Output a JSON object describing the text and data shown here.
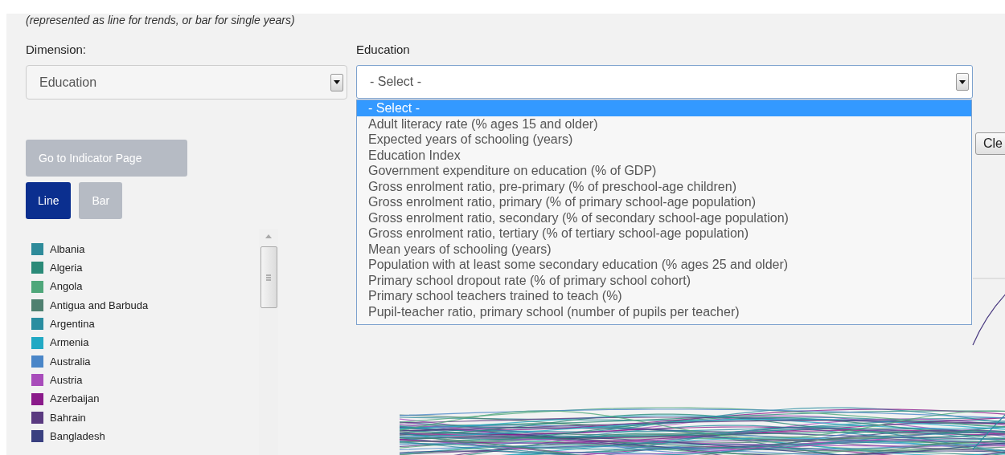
{
  "caption": "(represented as line for trends, or bar for single years)",
  "dimension": {
    "label": "Dimension:",
    "value": "Education"
  },
  "indicator": {
    "label": "Education",
    "value": "- Select -",
    "expanded": true,
    "options": [
      {
        "label": "- Select -",
        "selected": true
      },
      {
        "label": "Adult literacy rate (% ages 15 and older)",
        "selected": false
      },
      {
        "label": "Expected years of schooling (years)",
        "selected": false
      },
      {
        "label": "Education Index",
        "selected": false
      },
      {
        "label": "Government expenditure on education (% of GDP)",
        "selected": false
      },
      {
        "label": "Gross enrolment ratio, pre-primary (% of preschool-age children)",
        "selected": false
      },
      {
        "label": "Gross enrolment ratio, primary (% of primary school-age population)",
        "selected": false
      },
      {
        "label": "Gross enrolment ratio, secondary (% of secondary school-age population)",
        "selected": false
      },
      {
        "label": "Gross enrolment ratio, tertiary (% of tertiary school-age population)",
        "selected": false
      },
      {
        "label": "Mean years of schooling (years)",
        "selected": false
      },
      {
        "label": "Population with at least some secondary education (% ages 25 and older)",
        "selected": false
      },
      {
        "label": "Primary school dropout rate (% of primary school cohort)",
        "selected": false
      },
      {
        "label": "Primary school teachers trained to teach (%)",
        "selected": false
      },
      {
        "label": "Pupil-teacher ratio, primary school (number of pupils per teacher)",
        "selected": false
      }
    ]
  },
  "clear_button": "Cle",
  "indicator_page_button": "Go to Indicator Page",
  "chart_types": [
    {
      "label": "Line",
      "selected": true
    },
    {
      "label": "Bar",
      "selected": false
    }
  ],
  "countries": [
    {
      "name": "Albania",
      "color": "#2e8b9a"
    },
    {
      "name": "Algeria",
      "color": "#2a8a78"
    },
    {
      "name": "Angola",
      "color": "#4fa77a"
    },
    {
      "name": "Antigua and Barbuda",
      "color": "#4f8070"
    },
    {
      "name": "Argentina",
      "color": "#2a8da0"
    },
    {
      "name": "Armenia",
      "color": "#22a9c4"
    },
    {
      "name": "Australia",
      "color": "#4a86c8"
    },
    {
      "name": "Austria",
      "color": "#a84cba"
    },
    {
      "name": "Azerbaijan",
      "color": "#8a1a8a"
    },
    {
      "name": "Bahrain",
      "color": "#5a3a80"
    },
    {
      "name": "Bangladesh",
      "color": "#3a4080"
    }
  ]
}
